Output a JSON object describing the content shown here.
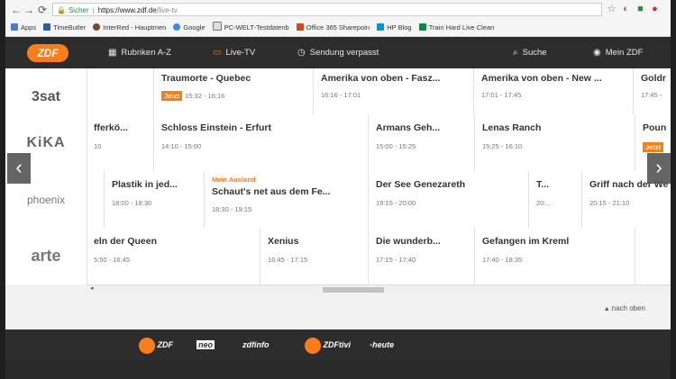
{
  "browser": {
    "secure_label": "Sicher",
    "url_host": "https://www.zdf.de",
    "url_path": "/live-tv",
    "bookmarks": [
      {
        "label": "Apps",
        "color": "#4a7bd0"
      },
      {
        "label": "TimeButler",
        "color": "#2a5fa0"
      },
      {
        "label": "InterRed - Hauptmen",
        "color": "#7a4a2a"
      },
      {
        "label": "Google",
        "color": "#4285f4"
      },
      {
        "label": "PC-WELT-Testdatenb",
        "color": "#333333"
      },
      {
        "label": "Office 365 Sharepoin",
        "color": "#d24726"
      },
      {
        "label": "HP Blog",
        "color": "#0096d6"
      },
      {
        "label": "Train Hard Live Clean",
        "color": "#0a8a4a"
      }
    ]
  },
  "zdf": {
    "logo_text": "ZDF",
    "nav": {
      "rubriken": "Rubriken A-Z",
      "livetv": "Live-TV",
      "verpasst": "Sendung verpasst",
      "suche": "Suche",
      "meinzdf": "Mein ZDF"
    }
  },
  "epg": {
    "channels": [
      {
        "logo": "3sat",
        "cells": [
          {
            "title": "",
            "time": ""
          },
          {
            "title": "Traumorte - Quebec",
            "badge": "Jetzt",
            "time": "15:32 - 16:16"
          },
          {
            "title": "Amerika von oben - Fasz...",
            "time": "16:16 - 17:01"
          },
          {
            "title": "Amerika von oben - New ...",
            "time": "17:01 - 17:45"
          },
          {
            "title": "Goldr",
            "time": "17:45 -"
          }
        ]
      },
      {
        "logo": "KiKA",
        "cells": [
          {
            "title": "fferkö...",
            "time": "10"
          },
          {
            "title": "Schloss Einstein - Erfurt",
            "time": "14:10 - 15:00"
          },
          {
            "title": "Armans Geh...",
            "time": "15:00 - 15:25"
          },
          {
            "title": "Lenas Ranch",
            "time": "15:25 - 16:10"
          },
          {
            "title": "Poun",
            "badge": "Jetzt",
            "time": ""
          }
        ]
      },
      {
        "logo": "phoenix",
        "cells": [
          {
            "title": "",
            "time": ""
          },
          {
            "title": "Plastik in jed...",
            "time": "18:00 - 18:30"
          },
          {
            "category": "Mein Ausland",
            "title": "Schaut's net aus dem Fe...",
            "time": "18:30 - 19:15"
          },
          {
            "title": "Der See Genezareth",
            "time": "19:15 - 20:00"
          },
          {
            "title": "T...",
            "time": "20:..."
          },
          {
            "title": "Griff nach der We",
            "time": "20:15 - 21:10"
          }
        ]
      },
      {
        "logo": "arte",
        "cells": [
          {
            "title": "eln der Queen",
            "time": "5:50 - 16:45"
          },
          {
            "title": "Xenius",
            "time": "16:45 - 17:15"
          },
          {
            "title": "Die wunderb...",
            "time": "17:15 - 17:40"
          },
          {
            "title": "Gefangen im Kreml",
            "time": "17:40 - 18:35"
          },
          {
            "title": "",
            "time": ""
          }
        ]
      }
    ],
    "nach_oben": "nach oben"
  },
  "footer": {
    "logos": [
      "ZDF",
      "neo",
      "zdfinfo",
      "ZDFtivi",
      "heute"
    ]
  },
  "colors": {
    "accent": "#fa7d19",
    "bar": "#2d2d2d"
  }
}
